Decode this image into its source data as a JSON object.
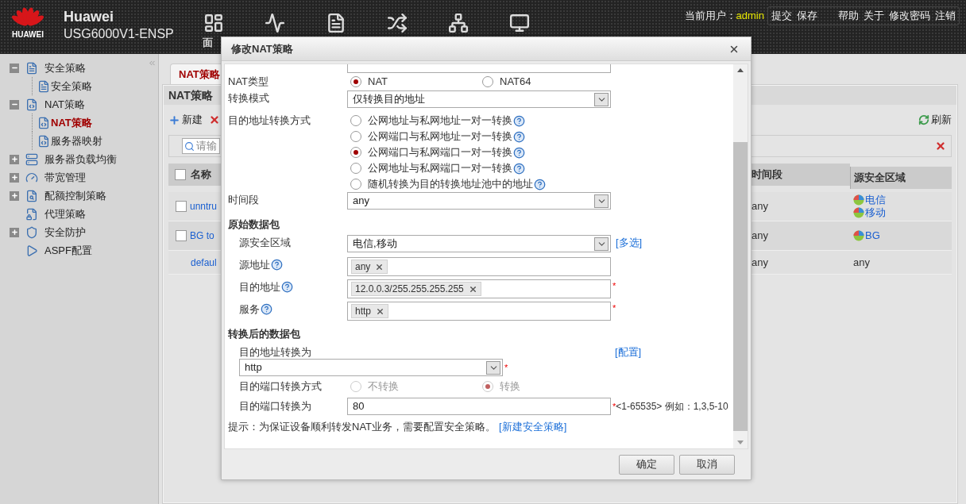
{
  "header": {
    "logo_text": "HUAWEI",
    "brand": "Huawei",
    "model": "USG6000V1-ENSP",
    "nav_label": "面",
    "user_prefix": "当前用户：",
    "user": "admin",
    "actions": [
      "提交",
      "保存"
    ],
    "links": [
      "帮助",
      "关于",
      "修改密码",
      "注销"
    ]
  },
  "sidebar": {
    "items": [
      {
        "label": "安全策略",
        "expanded": true,
        "children": [
          {
            "label": "安全策略",
            "selected": false
          }
        ]
      },
      {
        "label": "NAT策略",
        "expanded": true,
        "children": [
          {
            "label": "NAT策略",
            "selected": true
          },
          {
            "label": "服务器映射",
            "selected": false
          }
        ]
      },
      {
        "label": "服务器负载均衡",
        "expanded": false
      },
      {
        "label": "带宽管理",
        "expanded": false
      },
      {
        "label": "配额控制策略",
        "expanded": false
      },
      {
        "label": "代理策略"
      },
      {
        "label": "安全防护",
        "expanded": false
      },
      {
        "label": "ASPF配置"
      }
    ]
  },
  "tab": {
    "label": "NAT策略",
    "selected": true
  },
  "panel": {
    "title": "NAT策略",
    "new": "新建",
    "refresh": "刷新",
    "search_placeholder": "请输",
    "table": {
      "all_checked": false,
      "columns": [
        "名称",
        "时间段",
        "源安全区域"
      ],
      "rows": [
        {
          "name": "unntru",
          "checked": false,
          "time": "any",
          "zones": [
            {
              "label": "电信",
              "kind": "zone"
            },
            {
              "label": "移动",
              "kind": "zone"
            }
          ]
        },
        {
          "name": "BG to",
          "checked": false,
          "time": "any",
          "zones": [
            {
              "label": "BG",
              "kind": "zone"
            }
          ]
        },
        {
          "name": "defaul",
          "time": "any",
          "zones": [
            {
              "label": "any",
              "kind": "plain"
            }
          ]
        }
      ]
    }
  },
  "modal": {
    "title": "修改NAT策略",
    "fields": [
      {
        "kind": "radio",
        "label": "NAT类型",
        "options": [
          {
            "label": "NAT",
            "selected": true
          },
          {
            "label": "NAT64",
            "selected": false
          }
        ]
      },
      {
        "kind": "select",
        "label": "转换模式",
        "value": "仅转换目的地址"
      },
      {
        "kind": "radio-list",
        "label": "目的地址转换方式",
        "options": [
          {
            "label": "公网地址与私网地址一对一转换",
            "selected": false
          },
          {
            "label": "公网端口与私网地址一对一转换",
            "selected": false
          },
          {
            "label": "公网端口与私网端口一对一转换",
            "selected": true
          },
          {
            "label": "公网地址与私网端口一对一转换",
            "selected": false
          },
          {
            "label": "随机转换为目的转换地址池中的地址",
            "selected": false
          }
        ]
      },
      {
        "kind": "select",
        "label": "时间段",
        "value": "any"
      },
      {
        "kind": "section",
        "label": "原始数据包",
        "fields": [
          {
            "kind": "select",
            "label": "源安全区域",
            "value": "电信,移动",
            "link": "[多选]"
          },
          {
            "kind": "tags",
            "label": "源地址",
            "help": true,
            "tags": [
              "any"
            ]
          },
          {
            "kind": "tags",
            "label": "目的地址",
            "help": true,
            "tags": [
              "12.0.0.3/255.255.255.255"
            ],
            "mark": "*"
          },
          {
            "kind": "tags",
            "label": "服务",
            "help": true,
            "tags": [
              "http"
            ],
            "mark": "*"
          }
        ]
      },
      {
        "kind": "section",
        "label": "转换后的数据包",
        "fields": [
          {
            "kind": "select-below",
            "label": "目的地址转换为",
            "value": "http",
            "link": "[配置]",
            "mark": "*"
          },
          {
            "kind": "radio",
            "label": "目的端口转换方式",
            "disabled": true,
            "options": [
              {
                "label": "不转换",
                "selected": false
              },
              {
                "label": "转换",
                "selected": true
              }
            ]
          },
          {
            "kind": "input",
            "label": "目的端口转换为",
            "value": "80",
            "mark": "*",
            "note": "<1-65535> 例如：1,3,5-10"
          }
        ]
      }
    ],
    "hint": "提示：为保证设备顺利转发NAT业务，需要配置安全策略。",
    "hint_link": "[新建安全策略]",
    "buttons": [
      "确定",
      "取消"
    ]
  }
}
